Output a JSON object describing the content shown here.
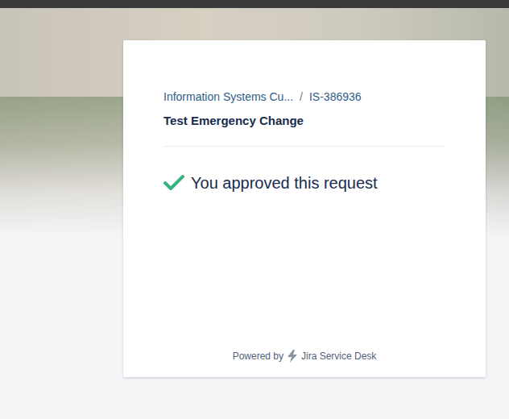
{
  "breadcrumbs": [
    {
      "label": "Information Systems Cu..."
    },
    {
      "label": "IS-386936"
    }
  ],
  "separator": "/",
  "title": "Test Emergency Change",
  "status": {
    "message": "You approved this request",
    "approved": true
  },
  "footer": {
    "prefix": "Powered by",
    "product": "Jira Service Desk"
  }
}
